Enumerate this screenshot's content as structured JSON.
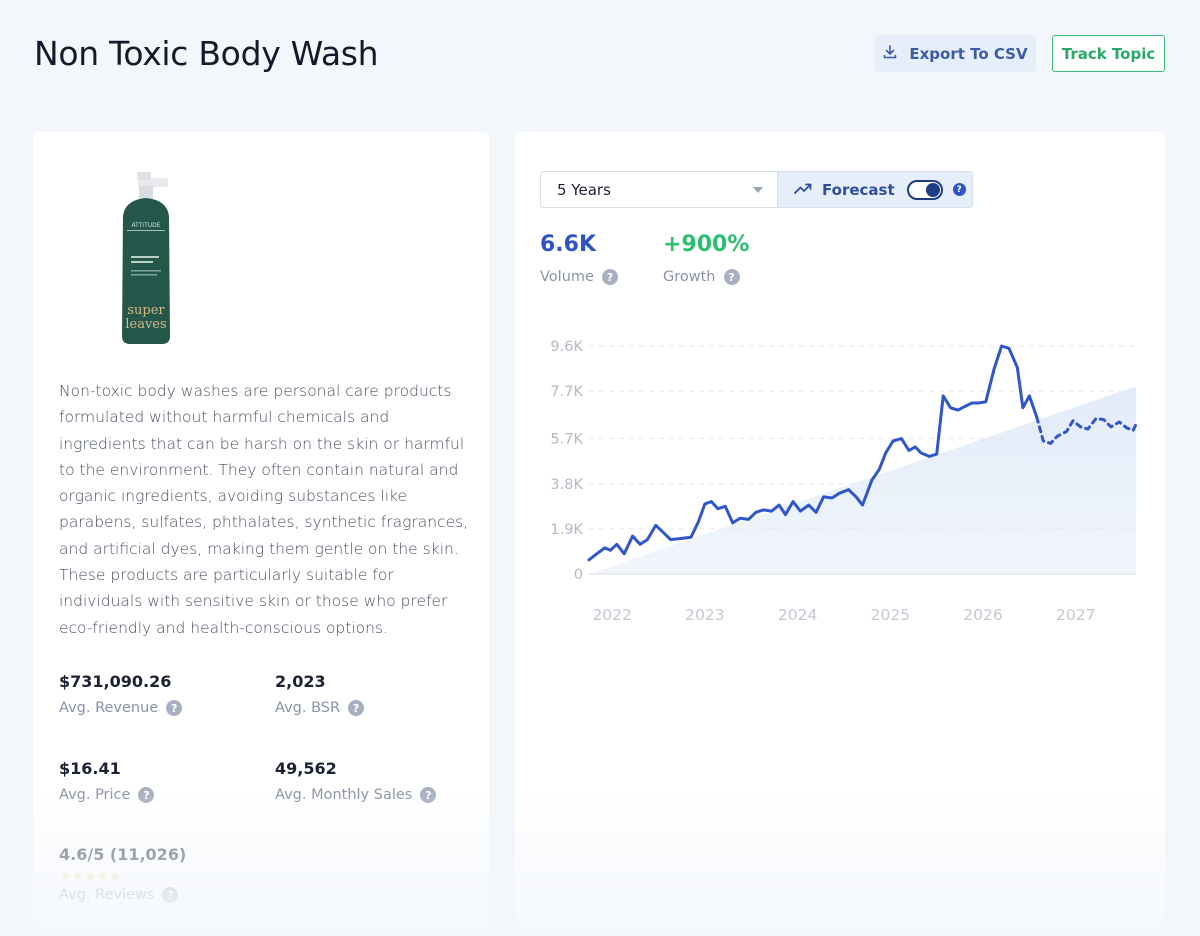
{
  "header": {
    "title": "Non Toxic Body Wash",
    "export_label": "Export To CSV",
    "track_label": "Track Topic"
  },
  "product": {
    "bottle_brand": "ATTITUDE",
    "bottle_line1": "super",
    "bottle_line2": "leaves",
    "description": "Non-toxic body washes are personal care products formulated without harmful chemicals and ingredients that can be harsh on the skin or harmful to the environment. They often contain natural and organic ingredients, avoiding substances like parabens, sulfates, phthalates, synthetic fragrances, and artificial dyes, making them gentle on the skin. These products are particularly suitable for individuals with sensitive skin or those who prefer eco-friendly and health-conscious options."
  },
  "metrics": {
    "avg_revenue": {
      "value": "$731,090.26",
      "label": "Avg. Revenue"
    },
    "avg_bsr": {
      "value": "2,023",
      "label": "Avg. BSR"
    },
    "avg_price": {
      "value": "$16.41",
      "label": "Avg. Price"
    },
    "avg_monthly_sales": {
      "value": "49,562",
      "label": "Avg. Monthly Sales"
    },
    "avg_reviews": {
      "value": "4.6/5 (11,026)",
      "label": "Avg. Reviews",
      "rating": 4.6
    }
  },
  "controls": {
    "range_selected": "5 Years",
    "forecast_label": "Forecast",
    "forecast_enabled": true
  },
  "stats": {
    "volume": {
      "value": "6.6K",
      "label": "Volume",
      "color": "#2f55c4"
    },
    "growth": {
      "value": "+900%",
      "label": "Growth",
      "color": "#2bbf74"
    }
  },
  "icons": {
    "export": "download-icon",
    "forecast": "trend-up-icon",
    "help": "question-circle-icon",
    "dropdown": "caret-down-icon"
  },
  "colors": {
    "line": "#3057c9",
    "trend_fill": "#e8f0fb",
    "accent_green": "#2bbf74"
  },
  "chart_data": {
    "type": "line",
    "ylim": [
      0,
      9600
    ],
    "y_ticks": [
      {
        "v": 0,
        "label": "0"
      },
      {
        "v": 1900,
        "label": "1.9K"
      },
      {
        "v": 3800,
        "label": "3.8K"
      },
      {
        "v": 5700,
        "label": "5.7K"
      },
      {
        "v": 7700,
        "label": "7.7K"
      },
      {
        "v": 9600,
        "label": "9.6K"
      }
    ],
    "x_ticks": [
      {
        "v": 2022,
        "label": "2022"
      },
      {
        "v": 2023,
        "label": "2023"
      },
      {
        "v": 2024,
        "label": "2024"
      },
      {
        "v": 2025,
        "label": "2025"
      },
      {
        "v": 2026,
        "label": "2026"
      },
      {
        "v": 2027,
        "label": "2027"
      }
    ],
    "xlim": [
      2021.75,
      2027.65
    ],
    "grid": true,
    "trend": [
      [
        2021.75,
        0
      ],
      [
        2027.65,
        7900
      ]
    ],
    "series": [
      {
        "style": "solid",
        "points": [
          [
            2021.75,
            600
          ],
          [
            2021.85,
            900
          ],
          [
            2021.92,
            1100
          ],
          [
            2021.98,
            1000
          ],
          [
            2022.05,
            1250
          ],
          [
            2022.13,
            850
          ],
          [
            2022.22,
            1600
          ],
          [
            2022.3,
            1250
          ],
          [
            2022.38,
            1450
          ],
          [
            2022.47,
            2050
          ],
          [
            2022.55,
            1750
          ],
          [
            2022.63,
            1450
          ],
          [
            2022.75,
            1500
          ],
          [
            2022.85,
            1550
          ],
          [
            2022.93,
            2200
          ],
          [
            2023.0,
            2950
          ],
          [
            2023.07,
            3050
          ],
          [
            2023.14,
            2750
          ],
          [
            2023.22,
            2850
          ],
          [
            2023.3,
            2150
          ],
          [
            2023.38,
            2350
          ],
          [
            2023.47,
            2300
          ],
          [
            2023.55,
            2600
          ],
          [
            2023.63,
            2700
          ],
          [
            2023.72,
            2650
          ],
          [
            2023.8,
            2900
          ],
          [
            2023.87,
            2500
          ],
          [
            2023.95,
            3050
          ],
          [
            2024.03,
            2650
          ],
          [
            2024.12,
            2900
          ],
          [
            2024.2,
            2600
          ],
          [
            2024.28,
            3250
          ],
          [
            2024.37,
            3200
          ],
          [
            2024.45,
            3400
          ],
          [
            2024.55,
            3550
          ],
          [
            2024.63,
            3250
          ],
          [
            2024.7,
            2900
          ],
          [
            2024.8,
            3950
          ],
          [
            2024.88,
            4400
          ],
          [
            2024.95,
            5100
          ],
          [
            2025.03,
            5600
          ],
          [
            2025.12,
            5700
          ],
          [
            2025.2,
            5200
          ],
          [
            2025.27,
            5350
          ],
          [
            2025.33,
            5100
          ],
          [
            2025.42,
            4950
          ],
          [
            2025.5,
            5050
          ],
          [
            2025.57,
            7500
          ],
          [
            2025.65,
            7000
          ],
          [
            2025.73,
            6900
          ],
          [
            2025.8,
            7050
          ],
          [
            2025.88,
            7200
          ],
          [
            2025.95,
            7200
          ],
          [
            2026.03,
            7250
          ],
          [
            2026.12,
            8650
          ],
          [
            2026.2,
            9600
          ],
          [
            2026.28,
            9500
          ],
          [
            2026.37,
            8700
          ],
          [
            2026.43,
            7000
          ],
          [
            2026.5,
            7500
          ],
          [
            2026.58,
            6600
          ]
        ]
      },
      {
        "style": "dashed",
        "points": [
          [
            2026.58,
            6600
          ],
          [
            2026.65,
            5600
          ],
          [
            2026.73,
            5500
          ],
          [
            2026.8,
            5800
          ],
          [
            2026.9,
            6000
          ],
          [
            2026.97,
            6450
          ],
          [
            2027.05,
            6200
          ],
          [
            2027.13,
            6100
          ],
          [
            2027.22,
            6550
          ],
          [
            2027.3,
            6500
          ],
          [
            2027.38,
            6200
          ],
          [
            2027.47,
            6400
          ],
          [
            2027.55,
            6150
          ],
          [
            2027.62,
            6050
          ],
          [
            2027.65,
            6300
          ]
        ]
      }
    ]
  }
}
